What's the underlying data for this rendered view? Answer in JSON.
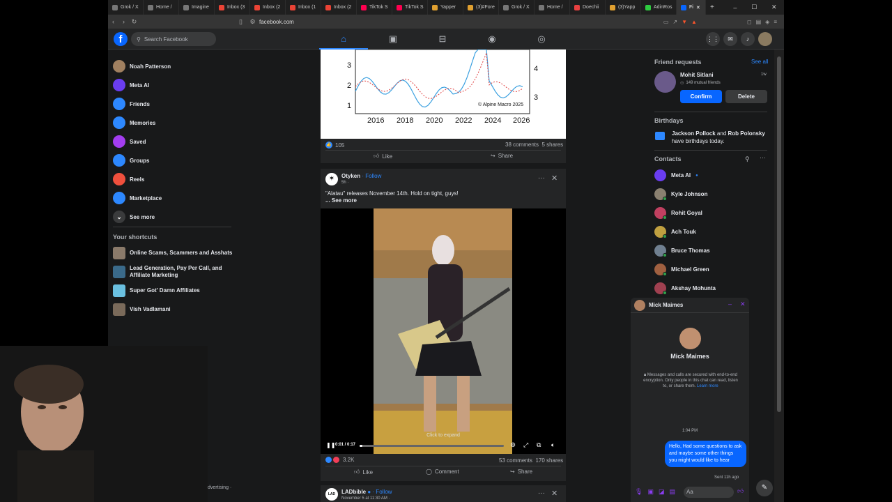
{
  "browser": {
    "tabs": [
      {
        "label": "Grok / X",
        "color": "#777"
      },
      {
        "label": "Home /",
        "color": "#777"
      },
      {
        "label": "Imagine",
        "color": "#777"
      },
      {
        "label": "Inbox (3",
        "color": "#ea4335"
      },
      {
        "label": "Inbox (2",
        "color": "#ea4335"
      },
      {
        "label": "Inbox (1",
        "color": "#ea4335"
      },
      {
        "label": "Inbox (2",
        "color": "#ea4335"
      },
      {
        "label": "TikTok S",
        "color": "#ff0050"
      },
      {
        "label": "TikTok S",
        "color": "#ff0050"
      },
      {
        "label": "Yapper",
        "color": "#e0a030"
      },
      {
        "label": "(3)#Fore",
        "color": "#e0a030"
      },
      {
        "label": "Grok / X",
        "color": "#777"
      },
      {
        "label": "Home /",
        "color": "#777"
      },
      {
        "label": "Doechii",
        "color": "#e84040"
      },
      {
        "label": "(3)Yapp",
        "color": "#e0a030"
      },
      {
        "label": "AdinRos",
        "color": "#2ecc40"
      }
    ],
    "active_tab": "Fi",
    "url": "facebook.com"
  },
  "header": {
    "logo": "f",
    "search_placeholder": "Search Facebook"
  },
  "sidebar": {
    "items": [
      {
        "label": "Noah Patterson",
        "icon": "avatar",
        "color": "#a08060"
      },
      {
        "label": "Meta AI",
        "icon": "meta-ai-icon",
        "color": "#6a3df0"
      },
      {
        "label": "Friends",
        "icon": "friends-icon",
        "color": "#2d88ff"
      },
      {
        "label": "Memories",
        "icon": "memories-icon",
        "color": "#2d88ff"
      },
      {
        "label": "Saved",
        "icon": "saved-icon",
        "color": "#a33df0"
      },
      {
        "label": "Groups",
        "icon": "groups-icon",
        "color": "#2d88ff"
      },
      {
        "label": "Reels",
        "icon": "reels-icon",
        "color": "#f0503d"
      },
      {
        "label": "Marketplace",
        "icon": "marketplace-icon",
        "color": "#2d88ff"
      },
      {
        "label": "See more",
        "icon": "chevron-down-icon",
        "color": "#3a3b3c"
      }
    ],
    "shortcuts_title": "Your shortcuts",
    "shortcuts": [
      {
        "label": "Online Scams, Scammers and Asshats",
        "color": "#8a7a6a"
      },
      {
        "label": "Lead Generation, Pay Per Call, and",
        "label2": "Affiliate Marketing",
        "color": "#3a6a8a"
      },
      {
        "label": "Super Got' Damn Affiliates",
        "color": "#6ac0e0"
      },
      {
        "label": "Vish Vadlamani",
        "color": "#7a6a5a"
      }
    ]
  },
  "post1": {
    "chart": {
      "y_left": [
        "3",
        "2",
        "1"
      ],
      "y_right": [
        "4",
        "3"
      ],
      "years": [
        "2016",
        "2018",
        "2020",
        "2022",
        "2024",
        "2026"
      ],
      "credit": "© Alpine Macro 2025"
    },
    "reactions": "105",
    "comments": "38 comments",
    "shares": "5 shares",
    "like": "Like",
    "share": "Share"
  },
  "post2": {
    "author": "Otyken",
    "follow": "· Follow",
    "time": "5h ·",
    "text": "\"Alatau\" releases November 14th. Hold on tight, guys!",
    "see_more": "... See more",
    "video": {
      "time": "0:01 / 0:17",
      "expand": "Click to expand",
      "progress": 0.02
    },
    "reactions": "3.2K",
    "comments": "53 comments",
    "shares": "170 shares",
    "like": "Like",
    "comment": "Comment",
    "share": "Share"
  },
  "post3": {
    "author": "LADbible",
    "follow": "· Follow",
    "time": "November 5 at 11:30 AM ·",
    "avatar_text": "LAD"
  },
  "right": {
    "friend_requests": "Friend requests",
    "see_all": "See all",
    "request": {
      "name": "Mohit Sitlani",
      "mutual": "149 mutual friends",
      "time": "1w",
      "confirm": "Confirm",
      "delete": "Delete"
    },
    "birthdays": "Birthdays",
    "birthday_names": "Jackson Pollock",
    "birthday_and": " and ",
    "birthday_names2": "Rob Polonsky",
    "birthday_rest": "have birthdays today.",
    "contacts_title": "Contacts",
    "contacts": [
      {
        "name": "Meta AI",
        "color": "#6a3df0"
      },
      {
        "name": "Kyle Johnson",
        "color": "#8a8070"
      },
      {
        "name": "Rohit Goyal",
        "color": "#c04060"
      },
      {
        "name": "Ach Touk",
        "color": "#c0a040"
      },
      {
        "name": "Bruce Thomas",
        "color": "#708090"
      },
      {
        "name": "Michael Green",
        "color": "#a06040"
      },
      {
        "name": "Akshay Mohunta",
        "color": "#a04050"
      }
    ]
  },
  "chat": {
    "name": "Mick Maimes",
    "e2e": "Messages and calls are secured with end-to-end encryption. Only people in this chat can read, listen to, or share them.",
    "learn_more": "Learn more",
    "time": "1:04 PM",
    "message": "Hello, Had some questions to ask and maybe some other things you might would like to hear",
    "sent": "Sent 11h ago",
    "input_placeholder": "Aa"
  },
  "webcam": {
    "caption": "dvertising ·"
  }
}
